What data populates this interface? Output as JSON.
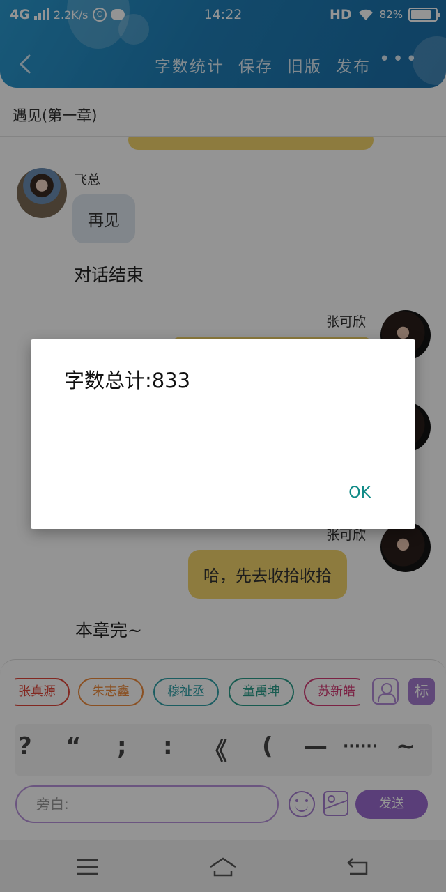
{
  "status_bar": {
    "network": "4G",
    "speed": "2.2K/s",
    "time": "14:22",
    "hd": "HD",
    "battery_percent": "82%",
    "battery_level": 0.82
  },
  "toolbar": {
    "word_count": "字数统计",
    "save": "保存",
    "old_version": "旧版",
    "publish": "发布",
    "more": "•••"
  },
  "chapter": {
    "title": "遇见(第一章)"
  },
  "chat": {
    "messages": [
      {
        "sender": "飞总",
        "text": "再见",
        "side": "left"
      },
      {
        "narration": "对话结束"
      },
      {
        "sender": "张可欣",
        "side": "right"
      },
      {
        "sender": "张可欣",
        "text": "哈，先去收拾收拾",
        "side": "right"
      },
      {
        "narration": "本章完~"
      }
    ]
  },
  "characters": [
    "张真源",
    "朱志鑫",
    "穆祉丞",
    "童禹坤",
    "苏新皓"
  ],
  "character_colors": [
    "#e0453a",
    "#ee8a3c",
    "#2fa0a8",
    "#2a9e8a",
    "#d43b76"
  ],
  "tag_button": "标",
  "punctuation": [
    "?",
    "“",
    ";",
    ":",
    "《",
    "(",
    "—",
    "······",
    "~"
  ],
  "input": {
    "placeholder": "旁白:",
    "send": "发送"
  },
  "dialog": {
    "message": "字数总计:833",
    "ok": "OK"
  },
  "colors": {
    "header": "#1f7fb8",
    "accent": "#9b6cd0",
    "bubble_right": "#f3d56b",
    "dialog_ok": "#0f8a86"
  }
}
